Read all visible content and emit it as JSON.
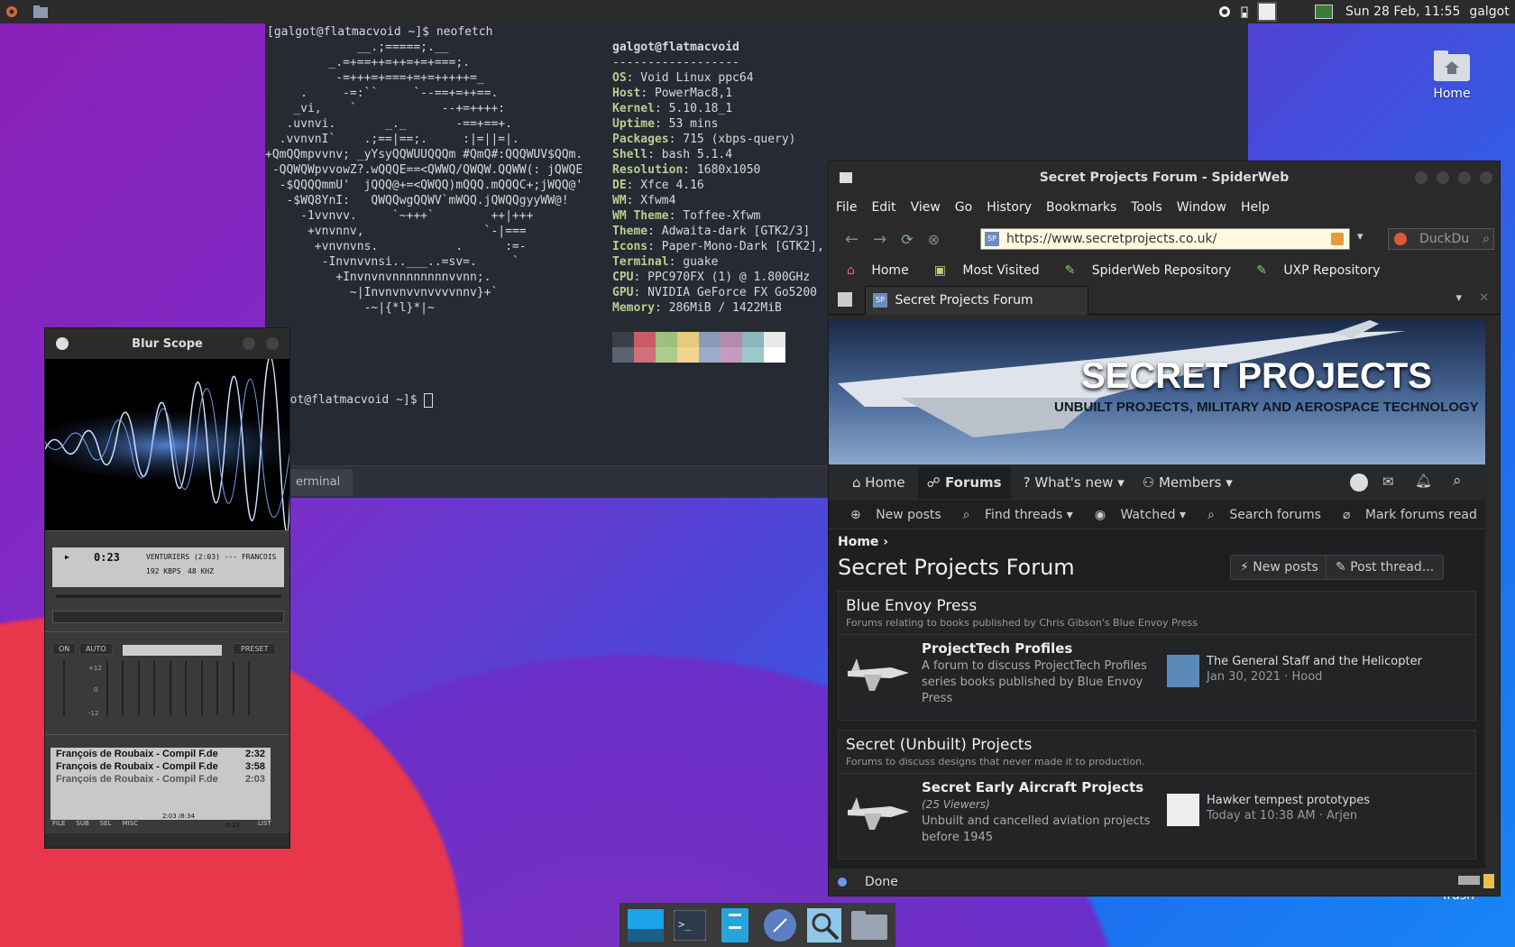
{
  "top_panel": {
    "clock": "Sun 28 Feb, 11:55",
    "user": "galgot"
  },
  "desktop": {
    "home_label": "Home",
    "trash_label": "Trash"
  },
  "terminal": {
    "prompt_cmd": "[galgot@flatmacvoid ~]$ neofetch",
    "ascii": "             __.;=====;.__\n         _.=+==++=++=+=+===;.\n          -=+++=+===+=+=+++++=_\n     .     -=:``     `--==+=++==.\n    _vi,    `            --+=++++:\n   .uvnvi.       _._       -==+==+.\n  .vvnvnI`    .;==|==;.     :|=||=|.\n+QmQQmpvvnv; _yYsyQQWUUQQQm #QmQ#:QQQWUV$QQm.\n -QQWQWpvvowZ?.wQQQE==<QWWQ/QWQW.QQWW(: jQWQE\n  -$QQQQmmU'  jQQQ@+=<QWQQ)mQQQ.mQQQC+;jWQQ@'\n   -$WQ8YnI:   QWQQwgQQWV`mWQQ.jQWQQgyyWW@!\n     -1vvnvv.     `~+++`        ++|+++\n      +vnvnnv,                 `-|===\n       +vnvnvns.           .      :=-\n        -Invnvvnsi..___..=sv=.     `\n          +Invnvnvnnnnnnnnvvnn;.\n            ~|Invnvnvvnvvvvnnv}+`\n              -~|{*l}*|~",
    "user_host": "galgot@flatmacvoid",
    "separator": "------------------",
    "info": [
      {
        "key": "OS",
        "value": ": Void Linux ppc64"
      },
      {
        "key": "Host",
        "value": ": PowerMac8,1"
      },
      {
        "key": "Kernel",
        "value": ": 5.10.18_1"
      },
      {
        "key": "Uptime",
        "value": ": 53 mins"
      },
      {
        "key": "Packages",
        "value": ": 715 (xbps-query)"
      },
      {
        "key": "Shell",
        "value": ": bash 5.1.4"
      },
      {
        "key": "Resolution",
        "value": ": 1680x1050"
      },
      {
        "key": "DE",
        "value": ": Xfce 4.16"
      },
      {
        "key": "WM",
        "value": ": Xfwm4"
      },
      {
        "key": "WM Theme",
        "value": ": Toffee-Xfwm"
      },
      {
        "key": "Theme",
        "value": ": Adwaita-dark [GTK2/3]"
      },
      {
        "key": "Icons",
        "value": ": Paper-Mono-Dark [GTK2],"
      },
      {
        "key": "Terminal",
        "value": ": guake"
      },
      {
        "key": "CPU",
        "value": ": PPC970FX (1) @ 1.800GHz"
      },
      {
        "key": "GPU",
        "value": ": NVIDIA GeForce FX Go5200"
      },
      {
        "key": "Memory",
        "value": ": 286MiB / 1422MiB"
      }
    ],
    "palette_top": [
      "#3c3f46",
      "#c95b64",
      "#9fbf7e",
      "#e9c97e",
      "#8a9bb8",
      "#b48aae",
      "#89b9bd",
      "#e8e8e8"
    ],
    "palette_bottom": [
      "#5c6370",
      "#d0707a",
      "#aecc90",
      "#f0d48f",
      "#9cabc7",
      "#c49bbf",
      "#9dc8cb",
      "#ffffff"
    ],
    "prompt2": "lgot@flatmacvoid ~]$ ",
    "tab_label": "erminal"
  },
  "player": {
    "title": "Blur Scope",
    "time": "0:23",
    "track": "VENTURIERS (2:03) --- FRANCOIS",
    "kbps": "192 KBPS",
    "khz": "48 KHZ",
    "eq_on": "ON",
    "eq_auto": "AUTO",
    "eq_preset": "PRESET",
    "eq_plus": "+12",
    "eq_zero": "0",
    "eq_minus": "-12",
    "playlist": [
      {
        "title": "François de Roubaix - Compil F.de",
        "time": "2:32"
      },
      {
        "title": "François de Roubaix - Compil F.de",
        "time": "3:58"
      },
      {
        "title": "François de Roubaix - Compil F.de",
        "time": "2:03"
      }
    ],
    "pl_buttons": [
      "FILE",
      "SUB",
      "SEL",
      "MISC"
    ],
    "pl_total": "2:03 /8:34",
    "pl_time": "0:23",
    "pl_list": "LIST"
  },
  "browser": {
    "title": "Secret Projects Forum - SpiderWeb",
    "menu": [
      "File",
      "Edit",
      "View",
      "Go",
      "History",
      "Bookmarks",
      "Tools",
      "Window",
      "Help"
    ],
    "url": "https://www.secretprojects.co.uk/",
    "search_placeholder": "DuckDu",
    "bookmarks": [
      "Home",
      "Most Visited",
      "SpiderWeb Repository",
      "UXP Repository"
    ],
    "tab_title": "Secret Projects Forum",
    "tab_favicon": "SP",
    "banner_title": "SECRET PROJECTS",
    "banner_sub": "UNBUILT PROJECTS, MILITARY AND AEROSPACE TECHNOLOGY",
    "nav": [
      "Home",
      "Forums",
      "What's new",
      "Members"
    ],
    "subnav": [
      "New posts",
      "Find threads",
      "Watched",
      "Search forums",
      "Mark forums read"
    ],
    "breadcrumb": "Home",
    "page_title": "Secret Projects Forum",
    "btn_new_posts": "New posts",
    "btn_post_thread": "Post thread...",
    "categories": [
      {
        "title": "Blue Envoy Press",
        "desc": "Forums relating to books published by Chris Gibson's Blue Envoy Press",
        "forum_title": "ProjectTech Profiles",
        "forum_extra": "",
        "forum_desc": "A forum to discuss ProjectTech Profiles series books published by Blue Envoy Press",
        "latest_title": "The General Staff and the Helicopter",
        "latest_meta": "Jan 30, 2021 · Hood"
      },
      {
        "title": "Secret (Unbuilt) Projects",
        "desc": "Forums to discuss designs that never made it to production.",
        "forum_title": "Secret Early Aircraft Projects",
        "forum_extra": "(25 Viewers)",
        "forum_desc": "Unbuilt and cancelled aviation projects before 1945",
        "latest_title": "Hawker tempest prototypes",
        "latest_meta": "Today at 10:38 AM · Arjen"
      }
    ],
    "status": "Done"
  }
}
